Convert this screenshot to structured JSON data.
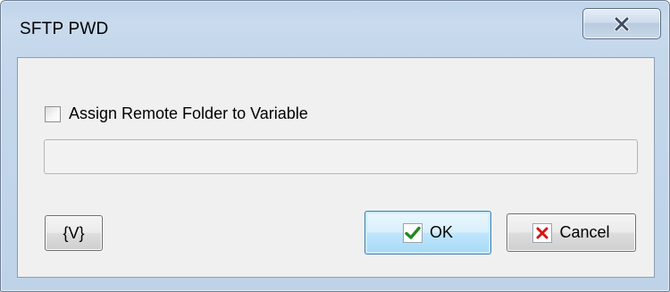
{
  "window": {
    "title": "SFTP PWD",
    "close_icon": "close-x-icon"
  },
  "options": {
    "assign_checkbox_label": "Assign Remote Folder to Variable",
    "assign_checked": false,
    "variable_value": "",
    "variable_placeholder": ""
  },
  "buttons": {
    "variable_label": "{V}",
    "ok_label": "OK",
    "ok_icon": "checkmark-icon",
    "cancel_label": "Cancel",
    "cancel_icon": "red-x-icon"
  },
  "colors": {
    "frame": "#c4d7eb",
    "ok_check": "#1f8a1f",
    "cancel_x": "#d51414"
  }
}
